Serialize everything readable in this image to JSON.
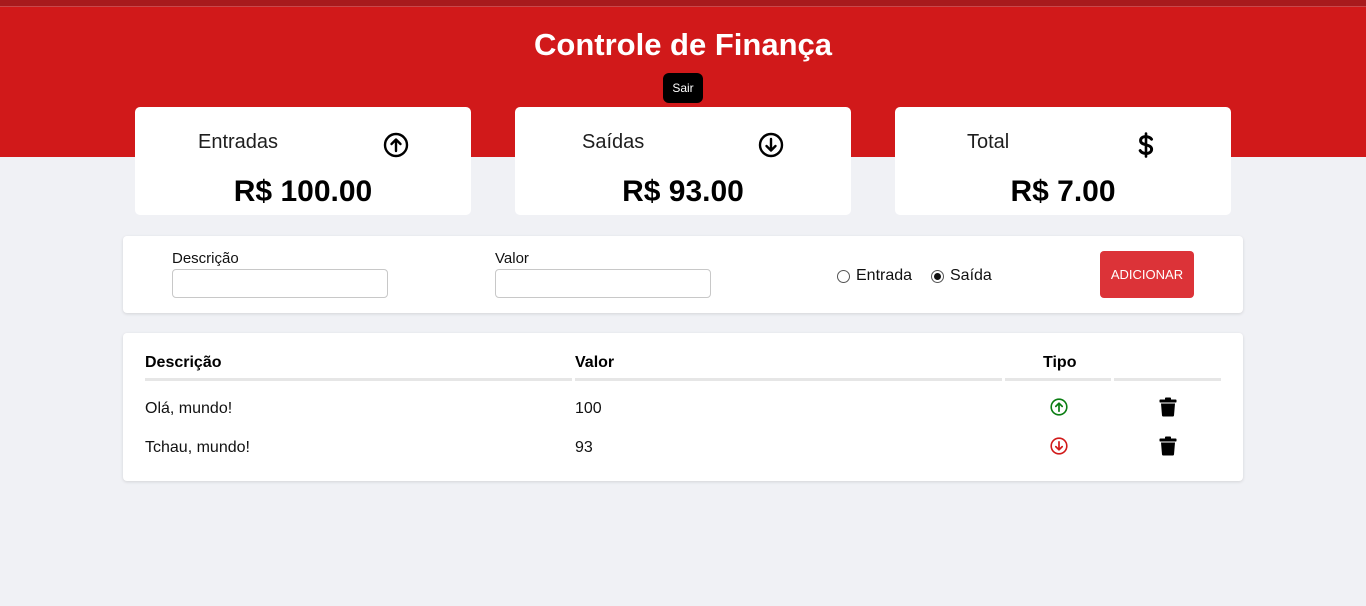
{
  "header": {
    "title": "Controle de Finança",
    "logout_label": "Sair"
  },
  "summary": [
    {
      "label": "Entradas",
      "icon": "arrow-up-circle-icon",
      "amount": "R$ 100.00"
    },
    {
      "label": "Saídas",
      "icon": "arrow-down-circle-icon",
      "amount": "R$ 93.00"
    },
    {
      "label": "Total",
      "icon": "dollar-icon",
      "amount": "R$ 7.00"
    }
  ],
  "form": {
    "description_label": "Descrição",
    "description_value": "",
    "value_label": "Valor",
    "value_value": "",
    "radio_entrada": "Entrada",
    "radio_saida": "Saída",
    "selected_type": "Saída",
    "add_label": "ADICIONAR"
  },
  "table": {
    "headers": [
      "Descrição",
      "Valor",
      "Tipo"
    ],
    "rows": [
      {
        "description": "Olá, mundo!",
        "value": "100",
        "type": "entrada"
      },
      {
        "description": "Tchau, mundo!",
        "value": "93",
        "type": "saida"
      }
    ]
  },
  "colors": {
    "header_bg": "#d1191a",
    "accent": "#dc3338",
    "income": "#0a7d12",
    "expense": "#d11a1a"
  }
}
